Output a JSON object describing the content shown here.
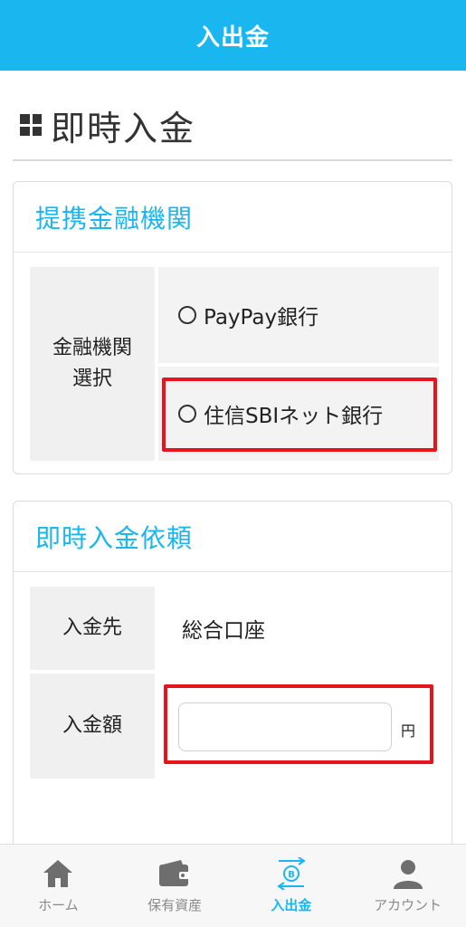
{
  "header": {
    "title": "入出金"
  },
  "page": {
    "title": "即時入金"
  },
  "partner_section": {
    "heading": "提携金融機関",
    "label_line1": "金融機関",
    "label_line2": "選択",
    "options": [
      "PayPay銀行",
      "住信SBIネット銀行"
    ]
  },
  "request_section": {
    "heading": "即時入金依頼",
    "destination_label": "入金先",
    "destination_value": "総合口座",
    "amount_label": "入金額",
    "amount_value": "",
    "amount_unit": "円"
  },
  "nav": {
    "items": [
      {
        "label": "ホーム",
        "icon": "home-icon"
      },
      {
        "label": "保有資産",
        "icon": "wallet-icon"
      },
      {
        "label": "入出金",
        "icon": "transfer-icon"
      },
      {
        "label": "アカウント",
        "icon": "account-icon"
      }
    ],
    "active_color": "#1ab6f0",
    "inactive_color": "#8a8a8a"
  },
  "colors": {
    "accent": "#1ab6f0",
    "highlight": "#e8141c"
  }
}
